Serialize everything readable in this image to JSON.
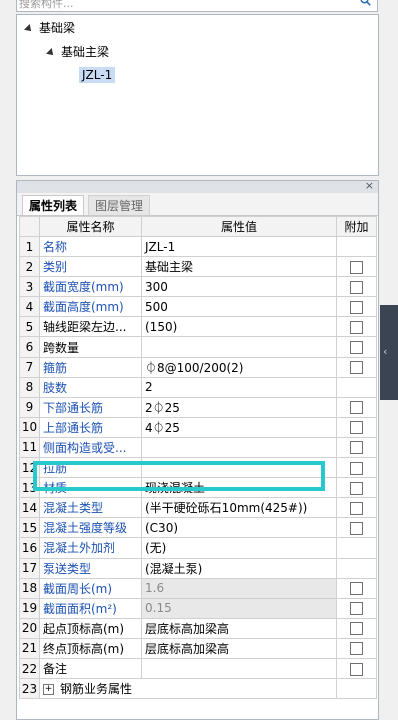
{
  "search": {
    "placeholder": "搜索构件..."
  },
  "tree": {
    "root": "基础梁",
    "child": "基础主梁",
    "leaf": "JZL-1"
  },
  "panel": {
    "tab_active": "属性列表",
    "tab_inactive": "图层管理",
    "close_symbol": "×"
  },
  "grid": {
    "headers": [
      "属性名称",
      "属性值",
      "附加"
    ],
    "rows": [
      {
        "num": "1",
        "name": "名称",
        "value": "JZL-1",
        "blue": true,
        "check": false,
        "disabled": false
      },
      {
        "num": "2",
        "name": "类别",
        "value": "基础主梁",
        "blue": true,
        "check": true,
        "disabled": false
      },
      {
        "num": "3",
        "name": "截面宽度(mm)",
        "value": "300",
        "blue": true,
        "check": true,
        "disabled": false
      },
      {
        "num": "4",
        "name": "截面高度(mm)",
        "value": "500",
        "blue": true,
        "check": true,
        "disabled": false
      },
      {
        "num": "5",
        "name": "轴线距梁左边...",
        "value": "(150)",
        "blue": false,
        "check": true,
        "disabled": false
      },
      {
        "num": "6",
        "name": "跨数量",
        "value": "",
        "blue": false,
        "check": true,
        "disabled": false
      },
      {
        "num": "7",
        "name": "箍筋",
        "value": "⏀8@100/200(2)",
        "blue": true,
        "check": true,
        "disabled": false
      },
      {
        "num": "8",
        "name": "肢数",
        "value": "2",
        "blue": true,
        "check": false,
        "disabled": false
      },
      {
        "num": "9",
        "name": "下部通长筋",
        "value": "2⏀25",
        "blue": true,
        "check": true,
        "disabled": false
      },
      {
        "num": "10",
        "name": "上部通长筋",
        "value": "4⏀25",
        "blue": true,
        "check": true,
        "disabled": false
      },
      {
        "num": "11",
        "name": "侧面构造或受...",
        "value": "",
        "blue": true,
        "check": true,
        "disabled": false
      },
      {
        "num": "12",
        "name": "拉筋",
        "value": "",
        "blue": true,
        "check": true,
        "disabled": false
      },
      {
        "num": "13",
        "name": "材质",
        "value": "现浇混凝土",
        "blue": true,
        "check": true,
        "disabled": false
      },
      {
        "num": "14",
        "name": "混凝土类型",
        "value": "(半干硬砼砾石10mm(425#))",
        "blue": true,
        "check": true,
        "disabled": false
      },
      {
        "num": "15",
        "name": "混凝土强度等级",
        "value": "(C30)",
        "blue": true,
        "check": true,
        "disabled": false
      },
      {
        "num": "16",
        "name": "混凝土外加剂",
        "value": "(无)",
        "blue": true,
        "check": false,
        "disabled": false
      },
      {
        "num": "17",
        "name": "泵送类型",
        "value": "(混凝土泵)",
        "blue": true,
        "check": false,
        "disabled": false
      },
      {
        "num": "18",
        "name": "截面周长(m)",
        "value": "1.6",
        "blue": true,
        "check": true,
        "disabled": true
      },
      {
        "num": "19",
        "name": "截面面积(m²)",
        "value": "0.15",
        "blue": true,
        "check": true,
        "disabled": true
      },
      {
        "num": "20",
        "name": "起点顶标高(m)",
        "value": "层底标高加梁高",
        "blue": false,
        "check": true,
        "disabled": false
      },
      {
        "num": "21",
        "name": "终点顶标高(m)",
        "value": "层底标高加梁高",
        "blue": false,
        "check": true,
        "disabled": false
      },
      {
        "num": "22",
        "name": "备注",
        "value": "",
        "blue": false,
        "check": true,
        "disabled": false
      }
    ],
    "expand_row": {
      "num": "23",
      "name": "钢筋业务属性"
    }
  }
}
